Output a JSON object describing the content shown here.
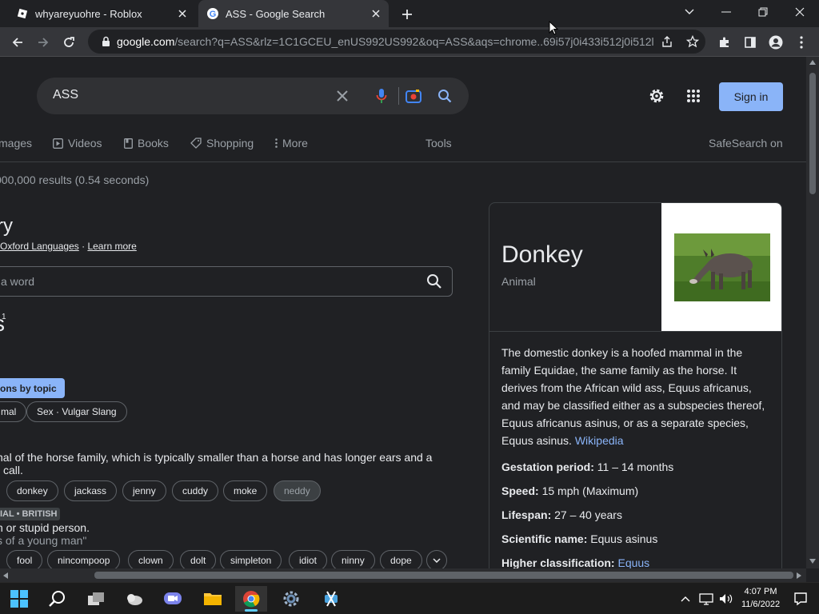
{
  "browser": {
    "tabs": [
      {
        "title": "whyareyuohre - Roblox"
      },
      {
        "title": "ASS - Google Search"
      }
    ],
    "url_host": "google.com",
    "url_path": "/search?q=ASS&rlz=1C1GCEU_enUS992US992&oq=ASS&aqs=chrome..69i57j0i433i512j0i512l3..."
  },
  "search": {
    "query": "ASS",
    "sign_in": "Sign in",
    "nav": {
      "images": "mages",
      "videos": "Videos",
      "books": "Books",
      "shopping": "Shopping",
      "more": "More",
      "tools": "Tools",
      "safesearch": "SafeSearch on"
    },
    "stats": "000,000 results (0.54 seconds)"
  },
  "dictionary": {
    "title": "ry",
    "source": "Oxford Languages",
    "sep": "·",
    "learn_more": "Learn more",
    "placeholder": "a word",
    "headword": "s",
    "sup": "1",
    "topic_button": "ons by topic",
    "topic_chips": [
      "mal",
      "Sex · Vulgar Slang"
    ],
    "def1_line1": "nal of the horse family, which is typically smaller than a horse and has longer ears and a",
    "def1_line2": "call.",
    "syn1": [
      "donkey",
      "jackass",
      "jenny",
      "cuddy",
      "moke",
      "neddy"
    ],
    "label2": "IAL • BRITISH",
    "def2_line1": "h or stupid person.",
    "def2_line2": "s of a young man\"",
    "syn2": [
      "fool",
      "nincompoop",
      "clown",
      "dolt",
      "simpleton",
      "idiot",
      "ninny",
      "dope"
    ]
  },
  "knowledge_panel": {
    "title": "Donkey",
    "subtitle": "Animal",
    "description": "The domestic donkey is a hoofed mammal in the family Equidae, the same family as the horse. It derives from the African wild ass, Equus africanus, and may be classified either as a subspecies thereof, Equus africanus asinus, or as a separate species, Equus asinus.",
    "wiki": "Wikipedia",
    "facts": [
      {
        "label": "Gestation period:",
        "value": "11 – 14 months"
      },
      {
        "label": "Speed:",
        "value": "15 mph (Maximum)"
      },
      {
        "label": "Lifespan:",
        "value": "27 – 40 years"
      },
      {
        "label": "Scientific name:",
        "value": "Equus asinus"
      },
      {
        "label": "Higher classification:",
        "value": "Equus"
      }
    ]
  },
  "taskbar": {
    "time": "4:07 PM",
    "date": "11/6/2022"
  }
}
